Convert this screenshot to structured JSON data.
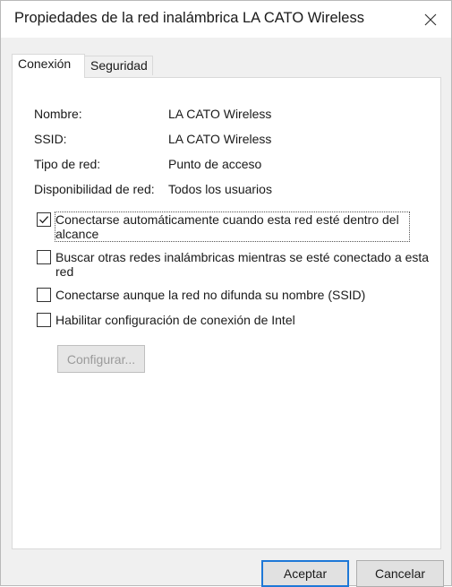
{
  "window": {
    "title": "Propiedades de la red inalámbrica LA CATO Wireless"
  },
  "tabs": [
    {
      "label": "Conexión",
      "active": true
    },
    {
      "label": "Seguridad",
      "active": false
    }
  ],
  "info": {
    "name_label": "Nombre:",
    "name_value": "LA CATO Wireless",
    "ssid_label": "SSID:",
    "ssid_value": "LA CATO Wireless",
    "network_type_label": "Tipo de red:",
    "network_type_value": "Punto de acceso",
    "availability_label": "Disponibilidad de red:",
    "availability_value": "Todos los usuarios"
  },
  "options": [
    {
      "label": "Conectarse automáticamente cuando esta red esté dentro del alcance",
      "checked": true
    },
    {
      "label": "Buscar otras redes inalámbricas mientras se esté conectado a esta red",
      "checked": false
    },
    {
      "label": "Conectarse aunque la red no difunda su nombre (SSID)",
      "checked": false
    },
    {
      "label": "Habilitar configuración de conexión de Intel",
      "checked": false
    }
  ],
  "buttons": {
    "configure": "Configurar...",
    "ok": "Aceptar",
    "cancel": "Cancelar"
  },
  "icons": {
    "close": "close-icon",
    "check": "check-icon"
  },
  "colors": {
    "accent": "#1e78d7",
    "panel": "#ffffff",
    "window": "#f0f0f0"
  }
}
